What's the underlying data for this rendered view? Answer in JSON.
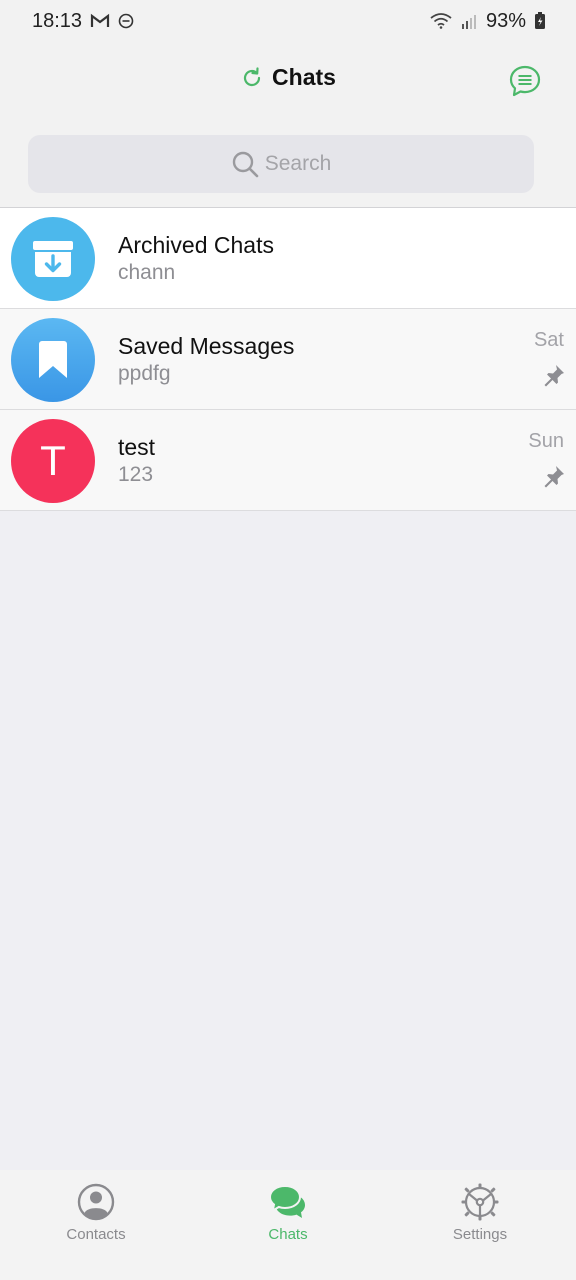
{
  "status_bar": {
    "time": "18:13",
    "battery": "93%"
  },
  "header": {
    "title": "Chats"
  },
  "search": {
    "placeholder": "Search"
  },
  "chats": [
    {
      "name": "Archived Chats",
      "preview": "chann",
      "time": "",
      "pinned": false,
      "avatar_icon": "archive-icon",
      "avatar_color": "#4cb8ec"
    },
    {
      "name": "Saved Messages",
      "preview": "ppdfg",
      "time": "Sat",
      "pinned": true,
      "avatar_icon": "bookmark-icon",
      "avatar_color": "#3fa2ea"
    },
    {
      "name": "test",
      "preview": "123",
      "time": "Sun",
      "pinned": true,
      "avatar_letter": "T",
      "avatar_color": "#f5325a"
    }
  ],
  "tabs": [
    {
      "label": "Contacts",
      "icon": "person-icon",
      "active": false
    },
    {
      "label": "Chats",
      "icon": "chat-bubbles-icon",
      "active": true
    },
    {
      "label": "Settings",
      "icon": "gear-icon",
      "active": false
    }
  ],
  "colors": {
    "accent": "#4cb86a",
    "archived_avatar": "#4cb8ec",
    "saved_avatar": "#3fa2ea",
    "test_avatar": "#f5325a"
  }
}
